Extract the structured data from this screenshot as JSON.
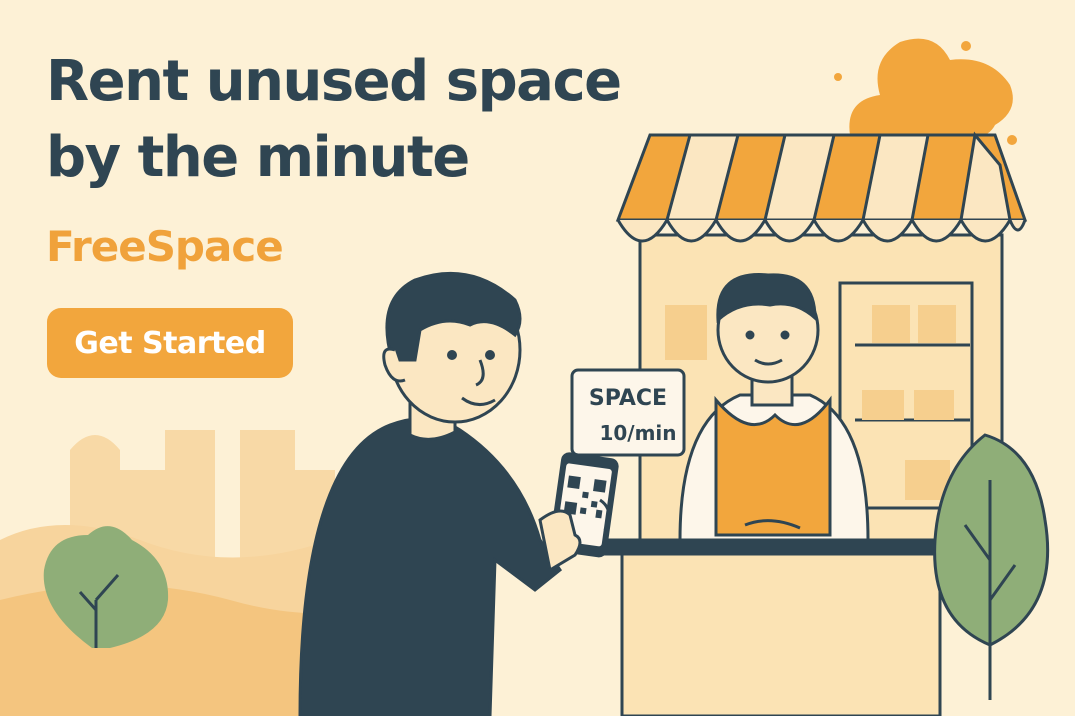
{
  "hero": {
    "headline_line1": "Rent unused space",
    "headline_line2": "by the minute",
    "brand": "FreeSpace",
    "cta_label": "Get Started"
  },
  "sign": {
    "title": "SPACE",
    "rate": "10/min"
  },
  "colors": {
    "background": "#fdf1d6",
    "text_dark": "#2f4552",
    "accent_orange": "#f2a63d",
    "tree_green": "#8fae78"
  }
}
